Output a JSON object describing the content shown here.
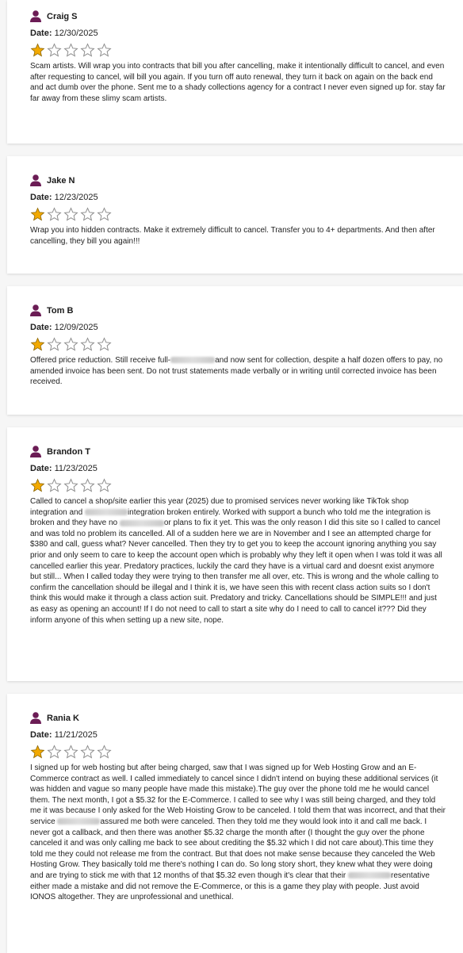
{
  "labels": {
    "date_prefix": "Date:"
  },
  "colors": {
    "accent": "#6b1c55",
    "star_fill": "#f2a900",
    "star_empty": "#8a8a8a"
  },
  "reviews": [
    {
      "author": "Craig S",
      "date": "12/30/2025",
      "rating": 1,
      "parts": [
        "Scam artists. Will wrap you into contracts that bill you after cancelling, make it intentionally difficult to cancel, and even after requesting to cancel, will bill you again. If you turn off auto renewal, they turn it back on again on the back end and act dumb over the phone. Sent me to a shady collections agency for a contract I never even signed up for. stay far far away from these slimy scam artists."
      ]
    },
    {
      "author": "Jake N",
      "date": "12/23/2025",
      "rating": 1,
      "parts": [
        "Wrap you into hidden contracts. Make it extremely difficult to cancel. Transfer you to 4+ departments. And then after cancelling, they bill you again!!!"
      ]
    },
    {
      "author": "Tom B",
      "date": "12/09/2025",
      "rating": 1,
      "parts": [
        "Offered price reduction. Still receive full-",
        "and now sent for collection, despite a half dozen offers to pay, no amended invoice has been sent. Do not trust statements made verbally or in writing until corrected invoice has been received."
      ]
    },
    {
      "author": "Brandon T",
      "date": "11/23/2025",
      "rating": 1,
      "parts": [
        "Called to cancel a shop/site earlier this year (2025) due to promised services never working like TikTok shop integration and ",
        "integration broken entirely. Worked with support a bunch who told me the integration is broken and they have no ",
        "or plans to fix it yet. This was the only reason I did this site so I called to cancel and was told no problem its cancelled. All of a sudden here we are in November and I see an attempted charge for $380 and call, guess what? Never cancelled. Then they try to get you to keep the account ignoring anything you say prior and only seem to care to keep the account open which is probably why they left it open when I was told it was all cancelled earlier this year. Predatory practices, luckily the card they have is a virtual card and doesnt exist anymore but still... When I called today they were trying to then transfer me all over, etc. This is wrong and the whole calling to confirm the cancellation should be illegal and I think it is, we have seen this with recent class action suits so I don't think this would make it through a class action suit. Predatory and tricky. Cancellations should be SIMPLE!!! and just as easy as opening an account! If I do not need to call to start a site why do I need to call to cancel it??? Did they inform anyone of this when setting up a new site, nope."
      ]
    },
    {
      "author": "Rania K",
      "date": "11/21/2025",
      "rating": 1,
      "parts": [
        "I signed up for web hosting but after being charged, saw that I was signed up for Web Hosting Grow and an E-Commerce contract as well. I called immediately to cancel since I didn't intend on buying these additional services (it was hidden and vague so many people have made this mistake).The guy over the phone told me he would cancel them. The next month, I got a $5.32 for the E-Commerce. I called to see why I was still being charged, and they told me it was because I only asked for the Web Hoisting Grow to be canceled. I told them that was incorrect, and that their service ",
        "assured me both were canceled. Then they told me they would look into it and call me back. I never got a callback, and then there was another $5.32 charge the month after (I thought the guy over the phone canceled it and was only calling me back to see about crediting the $5.32 which I did not care about).This time they told me they could not release me from the contract. But that does not make sense because they canceled the Web Hosting Grow. They basically told me there's nothing I can do. So long story short, they knew what they were doing and are trying to stick me with that 12 months of that $5.32 even though it's clear that their ",
        "resentative either made a mistake and did not remove the E-Commerce, or this is a game they play with people. Just avoid IONOS altogether. They are unprofessional and unethical."
      ]
    }
  ]
}
